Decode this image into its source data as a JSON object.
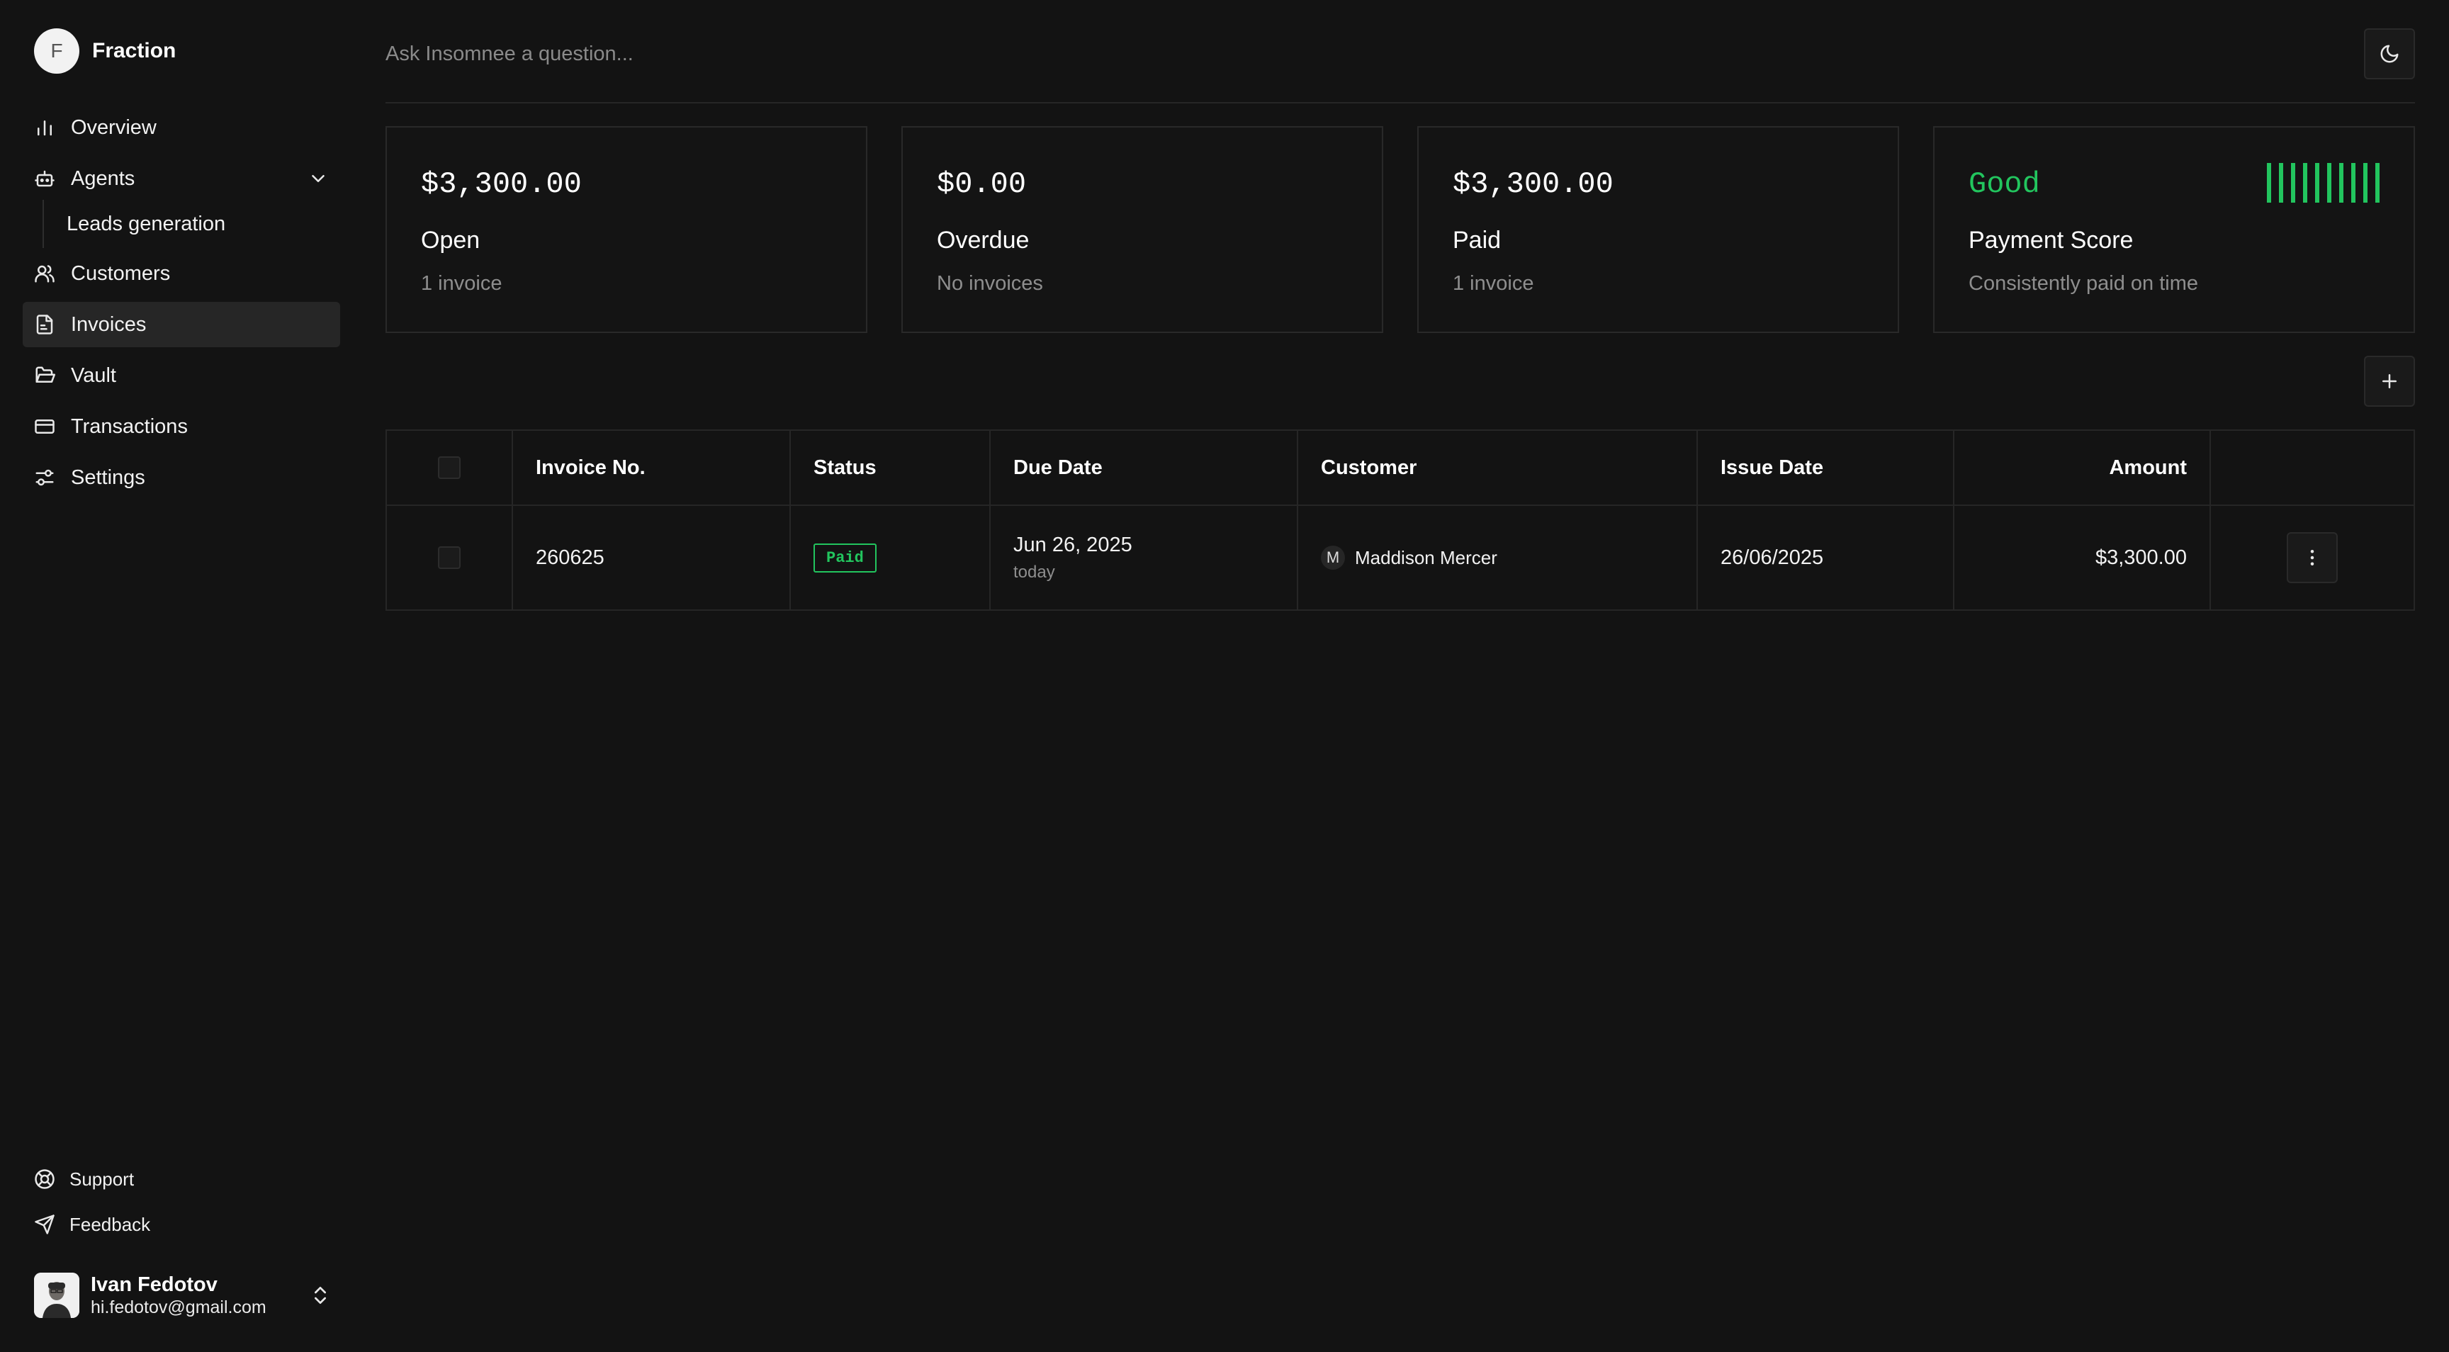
{
  "brand": {
    "logo_letter": "F",
    "name": "Fraction"
  },
  "sidebar": {
    "items": [
      {
        "label": "Overview",
        "icon": "bar-chart-icon"
      },
      {
        "label": "Agents",
        "icon": "bot-icon",
        "expanded": true,
        "sub_items": [
          {
            "label": "Leads generation"
          }
        ]
      },
      {
        "label": "Customers",
        "icon": "users-icon"
      },
      {
        "label": "Invoices",
        "icon": "file-invoice-icon",
        "active": true
      },
      {
        "label": "Vault",
        "icon": "folder-open-icon"
      },
      {
        "label": "Transactions",
        "icon": "credit-card-icon"
      },
      {
        "label": "Settings",
        "icon": "sliders-icon"
      }
    ],
    "bottom_links": [
      {
        "label": "Support",
        "icon": "life-buoy-icon"
      },
      {
        "label": "Feedback",
        "icon": "send-icon"
      }
    ],
    "user": {
      "name": "Ivan Fedotov",
      "email": "hi.fedotov@gmail.com"
    }
  },
  "search": {
    "placeholder": "Ask Insomnee a question...",
    "value": ""
  },
  "summary_cards": [
    {
      "amount": "$3,300.00",
      "title": "Open",
      "subtitle": "1 invoice"
    },
    {
      "amount": "$0.00",
      "title": "Overdue",
      "subtitle": "No invoices"
    },
    {
      "amount": "$3,300.00",
      "title": "Paid",
      "subtitle": "1 invoice"
    },
    {
      "amount": "Good",
      "title": "Payment Score",
      "subtitle": "Consistently paid on time",
      "score_bars": 10
    }
  ],
  "table": {
    "columns": [
      "",
      "Invoice No.",
      "Status",
      "Due Date",
      "Customer",
      "Issue Date",
      "Amount",
      ""
    ],
    "rows": [
      {
        "invoice_no": "260625",
        "status": "Paid",
        "due_date": "Jun 26, 2025",
        "due_relative": "today",
        "customer_initial": "M",
        "customer": "Maddison Mercer",
        "issue_date": "26/06/2025",
        "amount": "$3,300.00"
      }
    ]
  },
  "colors": {
    "background": "#131313",
    "accent_green": "#22c55e",
    "border": "#262626",
    "muted_text": "#8e8e8e"
  }
}
